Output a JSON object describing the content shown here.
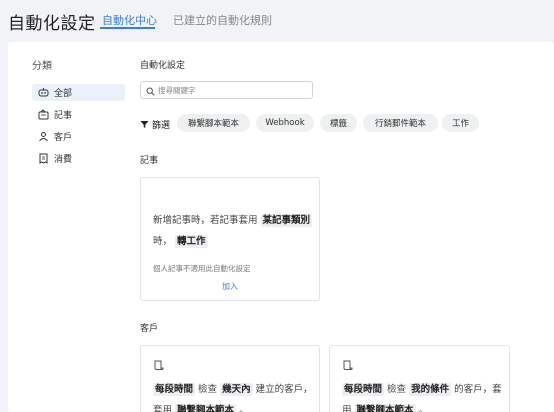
{
  "header": {
    "title": "自動化設定",
    "tabs": [
      {
        "label": "自動化中心",
        "active": true
      },
      {
        "label": "已建立的自動化規則",
        "active": false
      }
    ],
    "accent_color": "#3b7fd4"
  },
  "sidebar": {
    "title": "分類",
    "items": [
      {
        "label": "全部",
        "icon": "robot-icon",
        "active": true
      },
      {
        "label": "記事",
        "icon": "notebook-icon",
        "active": false
      },
      {
        "label": "客戶",
        "icon": "person-icon",
        "active": false
      },
      {
        "label": "消費",
        "icon": "receipt-icon",
        "active": false
      }
    ]
  },
  "main": {
    "title": "自動化設定",
    "search": {
      "placeholder": "搜尋關鍵字",
      "value": ""
    },
    "filter": {
      "label": "篩選",
      "chips": [
        "聯繫腳本範本",
        "Webhook",
        "標籤",
        "行銷郵件範本",
        "工作"
      ]
    },
    "sections": [
      {
        "title": "記事",
        "cards": [
          {
            "parts": [
              "新增記事時，若記事套用",
              "某記事類別",
              "時，",
              "轉工作"
            ],
            "note": "個人記事不適用此自動化設定",
            "action": "加入"
          }
        ]
      },
      {
        "title": "客戶",
        "cards": [
          {
            "parts": [
              "每段時間",
              "檢查",
              "幾天內",
              "建立的客戶，套用",
              "聯繫腳本範本",
              "。"
            ]
          },
          {
            "parts": [
              "每段時間",
              "檢查",
              "我的條件",
              "的客戶，套用",
              "聯繫腳本範本",
              "。"
            ]
          }
        ]
      }
    ]
  }
}
